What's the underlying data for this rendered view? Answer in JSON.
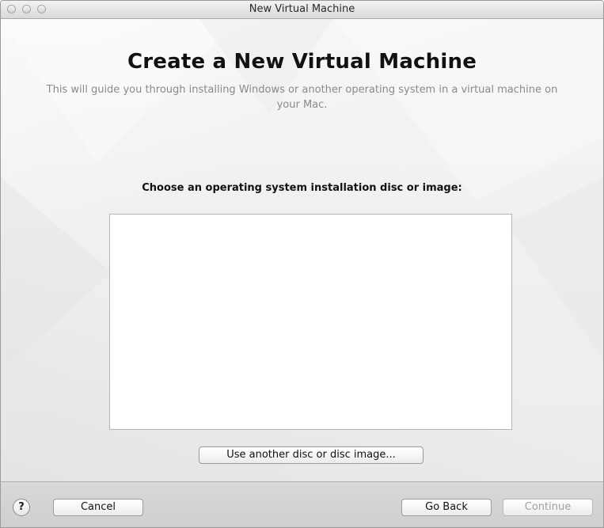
{
  "window": {
    "title": "New Virtual Machine"
  },
  "main": {
    "heading": "Create a New Virtual Machine",
    "subtitle": "This will guide you through installing Windows or another operating system in a virtual machine on your Mac.",
    "prompt": "Choose an operating system installation disc or image:",
    "disc_list_items": [],
    "use_another_label": "Use another disc or disc image..."
  },
  "footer": {
    "help_label": "?",
    "cancel_label": "Cancel",
    "go_back_label": "Go Back",
    "continue_label": "Continue",
    "continue_enabled": false
  },
  "colors": {
    "heading": "#111111",
    "subtitle": "#8a8a8a",
    "disabled_text": "#a0a0a0"
  },
  "icons": {
    "help": "question-mark-icon"
  }
}
